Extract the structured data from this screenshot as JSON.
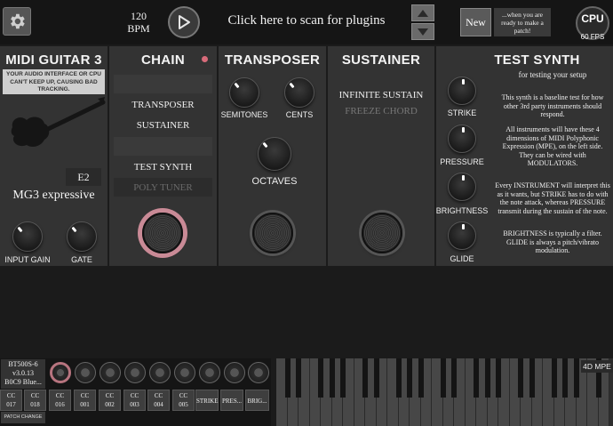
{
  "header": {
    "bpm_value": "120",
    "bpm_unit": "BPM",
    "scan_label": "Click here to scan for plugins",
    "new_label": "New",
    "new_hint": "...when you are ready to make a patch!",
    "cpu_label": "CPU",
    "fps_label": "60 FPS"
  },
  "mg3": {
    "title": "MIDI GUITAR 3",
    "warning": "YOUR AUDIO INTERFACE OR CPU CAN'T KEEP UP, CAUSING BAD TRACKING.",
    "note": "E2",
    "mode": "MG3 expressive",
    "knobs": [
      "INPUT GAIN",
      "GATE"
    ]
  },
  "chain": {
    "title": "CHAIN",
    "items": [
      "",
      "TRANSPOSER",
      "SUSTAINER",
      "",
      "TEST SYNTH",
      "POLY TUNER"
    ]
  },
  "transposer": {
    "title": "TRANSPOSER",
    "knobs": [
      "SEMITONES",
      "CENTS",
      "OCTAVES"
    ]
  },
  "sustainer": {
    "title": "SUSTAINER",
    "modes": [
      "INFINITE SUSTAIN",
      "FREEZE CHORD"
    ]
  },
  "test_synth": {
    "title": "TEST SYNTH",
    "subtitle": "for testing your setup",
    "knobs": [
      "STRIKE",
      "PRESSURE",
      "BRIGHTNESS",
      "GLIDE"
    ],
    "info": [
      "This synth is a baseline test for how other 3rd party instruments should respond.",
      "All instruments will have these 4 dimensions of MIDI Polyphonic Expression (MPE), on the left side. They can be wired with MODULATORS.",
      "Every INSTRUMENT will interpret this as it wants, but STRIKE has to do with the note attack, whereas PRESSURE transmit during the sustain of the note.",
      "BRIGHTNESS is typically a filter. GLIDE is always a pitch/vibrato modulation."
    ]
  },
  "bottom": {
    "device": [
      "BT500S-6",
      "v3.0.13",
      "B0C9 Blue..."
    ],
    "cc_buttons": [
      [
        "CC",
        "017"
      ],
      [
        "CC",
        "018"
      ],
      [
        "CC",
        "016"
      ],
      [
        "CC",
        "001"
      ],
      [
        "CC",
        "002"
      ],
      [
        "CC",
        "003"
      ],
      [
        "CC",
        "004"
      ],
      [
        "CC",
        "005"
      ],
      [
        "STRIKE",
        ""
      ],
      [
        "PRES...",
        ""
      ],
      [
        "BRIG...",
        ""
      ]
    ],
    "patch_change": "PATCH CHANGE",
    "keyboard_label": "4D MPE"
  },
  "colors": {
    "accent_pink": "#c98a96",
    "panel_bg": "#333333",
    "warning_bg": "#cfcfcf",
    "chain_indicator": "#d86b7a"
  }
}
